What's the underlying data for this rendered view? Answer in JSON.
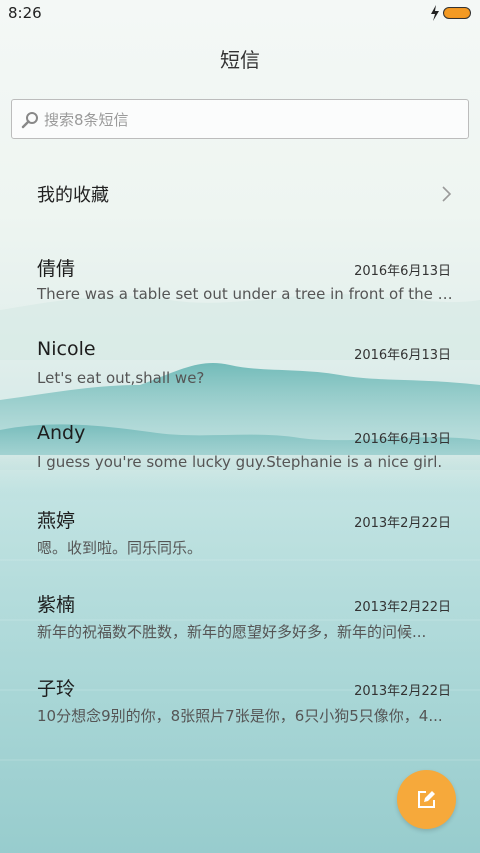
{
  "status_bar": {
    "time": "8:26",
    "battery_color": "#f39a24"
  },
  "header": {
    "title": "短信"
  },
  "search": {
    "placeholder": "搜索8条短信"
  },
  "favorites": {
    "label": "我的收藏"
  },
  "messages": [
    {
      "name": "倩倩",
      "date": "2016年6月13日",
      "preview": "There was a table set out under a tree in front of the ho..."
    },
    {
      "name": "Nicole",
      "date": "2016年6月13日",
      "preview": "Let's eat out,shall we?"
    },
    {
      "name": "Andy",
      "date": "2016年6月13日",
      "preview": "I guess you're some lucky guy.Stephanie is a nice girl."
    },
    {
      "name": "燕婷",
      "date": "2013年2月22日",
      "preview": "嗯。收到啦。同乐同乐。"
    },
    {
      "name": "紫楠",
      "date": "2013年2月22日",
      "preview": "新年的祝福数不胜数，新年的愿望好多好多，新年的问候..."
    },
    {
      "name": "子玲",
      "date": "2013年2月22日",
      "preview": "10分想念9别的你，8张照片7张是你，6只小狗5只像你，4..."
    }
  ],
  "fab": {
    "icon": "compose-icon",
    "color": "#f6a93b"
  }
}
